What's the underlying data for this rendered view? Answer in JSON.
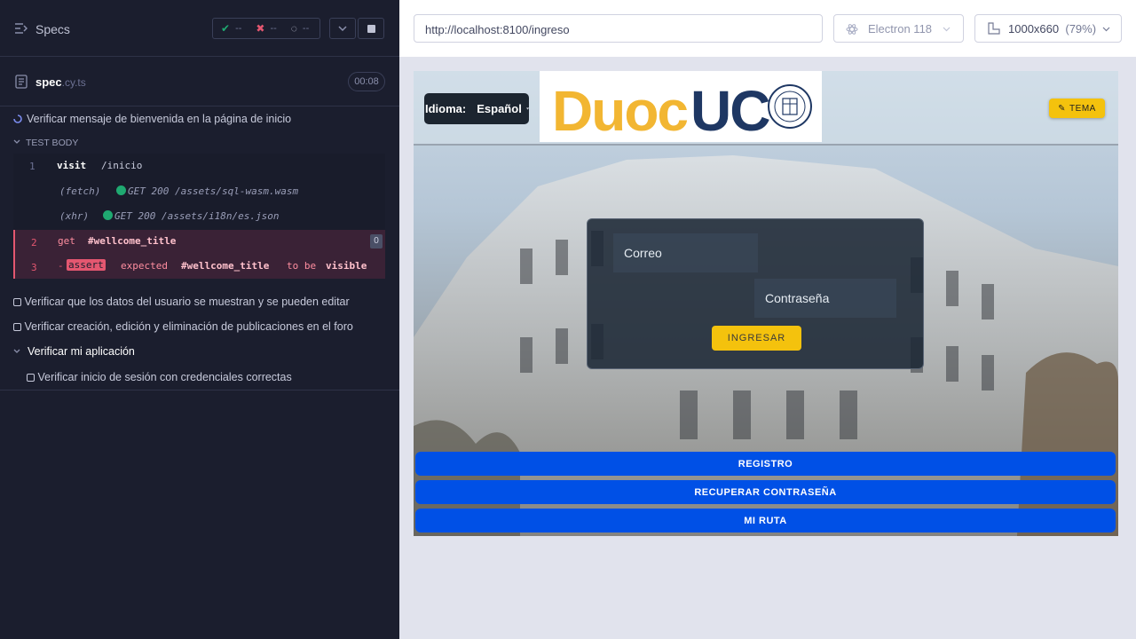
{
  "runner": {
    "title": "Specs",
    "stats": {
      "passed": "--",
      "failed": "--",
      "pending": "--"
    },
    "spec": {
      "name": "spec",
      "ext": ".cy.ts",
      "time": "00:08"
    },
    "tests": [
      {
        "label": "Verificar mensaje de bienvenida en la página de inicio"
      },
      {
        "label": "Verificar que los datos del usuario se muestran y se pueden editar"
      },
      {
        "label": "Verificar creación, edición y eliminación de publicaciones en el foro"
      }
    ],
    "suite": {
      "label": "Verificar mi aplicación",
      "test": "Verificar inicio de sesión con credenciales correctas"
    },
    "test_body": "TEST BODY",
    "commands": [
      {
        "num": "1",
        "name": "visit",
        "arg": "/inicio"
      },
      {
        "type": "(fetch)",
        "method": "GET",
        "status": "200",
        "path": "/assets/sql-wasm.wasm"
      },
      {
        "type": "(xhr)",
        "method": "GET",
        "status": "200",
        "path": "/assets/i18n/es.json"
      },
      {
        "num": "2",
        "name": "get",
        "arg": "#wellcome_title",
        "count": "0"
      },
      {
        "num": "3",
        "prefix": "-",
        "name": "assert",
        "expected": "expected",
        "selector": "#wellcome_title",
        "tobe": "to be",
        "visible": "visible"
      }
    ]
  },
  "browser": {
    "url": "http://localhost:8100/ingreso",
    "name": "Electron 118",
    "viewport": "1000x660",
    "zoom": "(79%)"
  },
  "app": {
    "lang_label": "Idioma:",
    "lang_value": "Español",
    "logo_duoc": "Duoc",
    "logo_uc": "UC",
    "theme": "TEMA",
    "email_placeholder": "Correo",
    "password_placeholder": "Contraseña",
    "login_button": "INGRESAR",
    "buttons": [
      "REGISTRO",
      "RECUPERAR CONTRASEÑA",
      "MI RUTA"
    ]
  }
}
